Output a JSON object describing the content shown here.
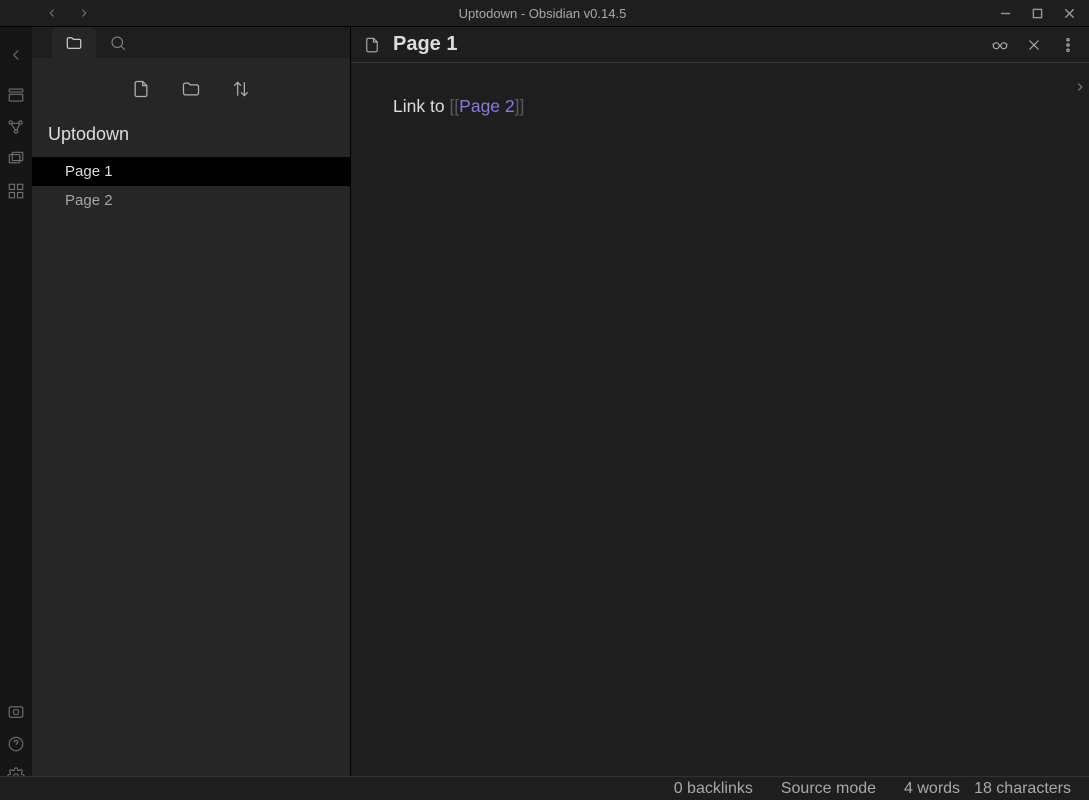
{
  "window": {
    "title": "Uptodown - Obsidian v0.14.5"
  },
  "sidebar": {
    "vault_name": "Uptodown",
    "files": [
      {
        "name": "Page 1",
        "active": true
      },
      {
        "name": "Page 2",
        "active": false
      }
    ]
  },
  "editor": {
    "title": "Page 1",
    "content": {
      "prefix_text": "Link to ",
      "bracket_open": "[[",
      "link_text": "Page 2",
      "bracket_close": "]]"
    }
  },
  "statusbar": {
    "backlinks": "0 backlinks",
    "mode": "Source mode",
    "words": "4 words",
    "chars": "18 characters"
  }
}
